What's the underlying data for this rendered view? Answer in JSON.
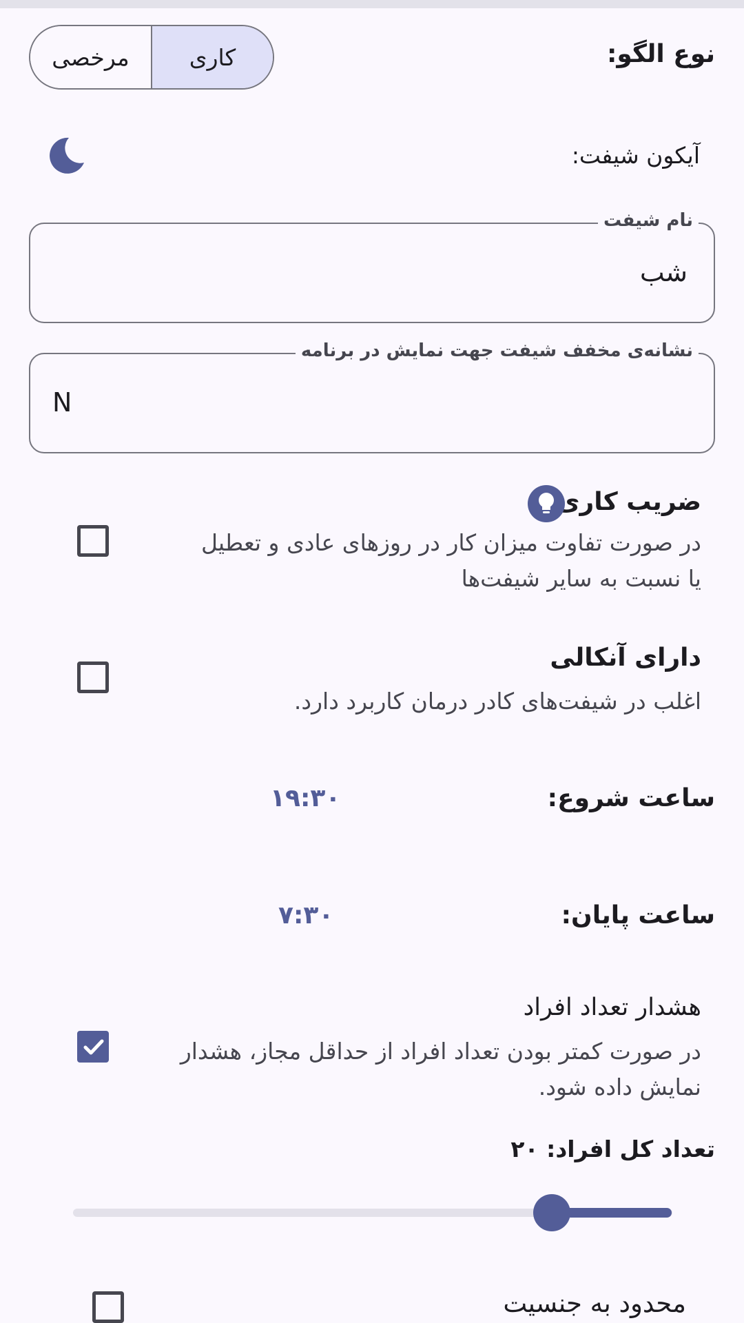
{
  "pattern_type": {
    "label": "نوع الگو:",
    "options": [
      "مرخصی",
      "کاری"
    ],
    "selected": "کاری"
  },
  "shift_icon": {
    "label": "آیکون شیفت:",
    "icon": "moon-icon"
  },
  "shift_name": {
    "label": "نام شیفت",
    "value": "شب"
  },
  "shift_abbrev": {
    "label": "نشانه‌ی مخفف شیفت جهت نمایش در برنامه",
    "value": "N"
  },
  "work_factor": {
    "title": "ضریب کاری",
    "desc_line1": "در صورت تفاوت میزان کار در روزهای عادی و تعطیل",
    "desc_line2": "یا نسبت به سایر شیفت‌ها",
    "checked": false,
    "icon": "lightbulb-icon"
  },
  "on_call": {
    "title": "دارای آنکالی",
    "desc": "اغلب در شیفت‌های کادر درمان کاربرد دارد.",
    "checked": false
  },
  "start_time": {
    "label": "ساعت شروع:",
    "value": "۱۹:۳۰"
  },
  "end_time": {
    "label": "ساعت پایان:",
    "value": "۷:۳۰"
  },
  "staff_warning": {
    "title": "هشدار تعداد افراد",
    "desc_line1": "در صورت کمتر بودن تعداد افراد از حداقل مجاز، هشدار",
    "desc_line2": "نمایش داده شود.",
    "checked": true
  },
  "total_staff": {
    "label": "تعداد کل افراد: ۲۰",
    "slider_fraction": 0.8
  },
  "gender_limited": {
    "title": "محدود به جنسیت",
    "checked": false
  },
  "colors": {
    "accent": "#535d98",
    "selected_segment": "#dfe0f8",
    "background": "#fbf8fe"
  }
}
